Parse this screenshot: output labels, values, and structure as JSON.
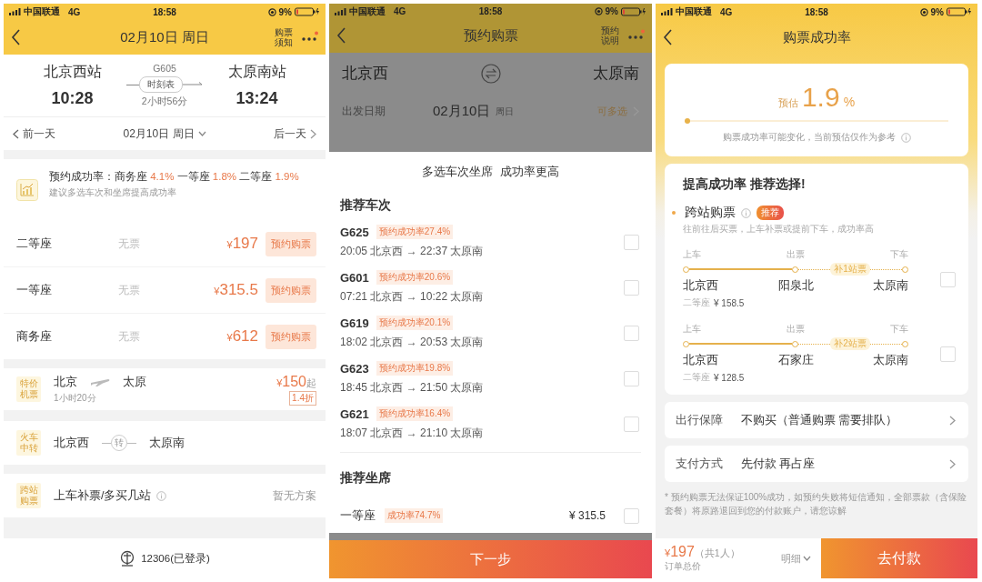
{
  "train_detail": {
    "status_bar": {
      "carrier": "中国联通",
      "network": "4G",
      "time": "18:58",
      "battery": "9%"
    },
    "nav": {
      "title": "02月10日 周日",
      "action": "购票须知"
    },
    "route": {
      "from": "北京西站",
      "to": "太原南站",
      "train": "G605",
      "depart": "10:28",
      "arrive": "13:24",
      "timetable": "时刻表",
      "duration": "2小时56分"
    },
    "date_bar": {
      "prev": "前一天",
      "date": "02月10日 周日",
      "next": "后一天"
    },
    "success": {
      "label": "预约成功率：",
      "rates": [
        {
          "seat": "商务座",
          "rate": "4.1%"
        },
        {
          "seat": "一等座",
          "rate": "1.8%"
        },
        {
          "seat": "二等座",
          "rate": "1.9%"
        }
      ],
      "hint": "建议多选车次和坐席提高成功率"
    },
    "seats": [
      {
        "name": "二等座",
        "status": "无票",
        "currency": "¥",
        "price": "197",
        "action": "预约购票"
      },
      {
        "name": "一等座",
        "status": "无票",
        "currency": "¥",
        "price": "315.5",
        "action": "预约购票"
      },
      {
        "name": "商务座",
        "status": "无票",
        "currency": "¥",
        "price": "612",
        "action": "预约购票"
      }
    ],
    "flight": {
      "tag": "特价机票",
      "from": "北京",
      "to": "太原",
      "duration": "1小时20分",
      "currency": "¥",
      "price": "150",
      "suffix": "起",
      "discount": "1.4折"
    },
    "transfer": {
      "tag": "火车中转",
      "from": "北京西",
      "via": "转",
      "to": "太原南"
    },
    "cross": {
      "tag": "跨站购票",
      "label": "上车补票/多买几站",
      "status": "暂无方案"
    },
    "footer": {
      "label": "12306(已登录)"
    }
  },
  "booking": {
    "status_bar": {
      "carrier": "中国联通",
      "network": "4G",
      "time": "18:58",
      "battery": "9%"
    },
    "nav": {
      "title": "预约购票",
      "action": "预约说明"
    },
    "form": {
      "from": "北京西",
      "to": "太原南",
      "date_label": "出发日期",
      "date": "02月10日",
      "weekday": "周日",
      "date_action": "可多选"
    },
    "sheet": {
      "title": "多选车次坐席  成功率更高",
      "trains_heading": "推荐车次",
      "trains": [
        {
          "code": "G625",
          "rate": "预约成功率27.4%",
          "schedule": "20:05 北京西 → 22:37 太原南",
          "checked": false
        },
        {
          "code": "G601",
          "rate": "预约成功率20.6%",
          "schedule": "07:21 北京西 → 10:22 太原南",
          "checked": false
        },
        {
          "code": "G619",
          "rate": "预约成功率20.1%",
          "schedule": "18:02 北京西 → 20:53 太原南",
          "checked": false
        },
        {
          "code": "G623",
          "rate": "预约成功率19.8%",
          "schedule": "18:45 北京西 → 21:50 太原南",
          "checked": false
        },
        {
          "code": "G621",
          "rate": "预约成功率16.4%",
          "schedule": "18:07 北京西 → 21:10 太原南",
          "checked": false
        }
      ],
      "seats_heading": "推荐坐席",
      "seats": [
        {
          "name": "一等座",
          "rate": "成功率74.7%",
          "price": "¥ 315.5",
          "checked": false
        }
      ]
    },
    "next_button": "下一步"
  },
  "success_rate": {
    "status_bar": {
      "carrier": "中国联通",
      "network": "4G",
      "time": "18:58",
      "battery": "9%"
    },
    "nav": {
      "title": "购票成功率"
    },
    "estimate": {
      "label": "预估",
      "value": "1.9",
      "unit": "%",
      "level": 0.019,
      "note": "购票成功率可能变化，当前预估仅作为参考"
    },
    "recommend": {
      "heading": "提高成功率 推荐选择!",
      "option": "跨站购票",
      "tag": "推荐",
      "desc": "往前往后买票，上车补票或提前下车，成功率高",
      "routes": [
        {
          "board_label": "上车",
          "ticket_label": "出票",
          "alight_label": "下车",
          "board": "北京西",
          "ticket": "阳泉北",
          "alight": "太原南",
          "extra": "补1站票",
          "seat": "二等座",
          "price": "¥ 158.5",
          "checked": false
        },
        {
          "board_label": "上车",
          "ticket_label": "出票",
          "alight_label": "下车",
          "board": "北京西",
          "ticket": "石家庄",
          "alight": "太原南",
          "extra": "补2站票",
          "seat": "二等座",
          "price": "¥ 128.5",
          "checked": false
        }
      ]
    },
    "rows": [
      {
        "label": "出行保障",
        "value": "不购买（普通购票 需要排队）"
      },
      {
        "label": "支付方式",
        "value": "先付款 再占座"
      }
    ],
    "note": "* 预约购票无法保证100%成功，如预约失败将短信通知，全部票款（含保险套餐）将原路退回到您的付款账户，请您谅解",
    "bottom": {
      "currency": "¥",
      "total": "197",
      "count": "（共1人）",
      "total_label": "订单总价",
      "details": "明细",
      "pay": "去付款"
    }
  }
}
